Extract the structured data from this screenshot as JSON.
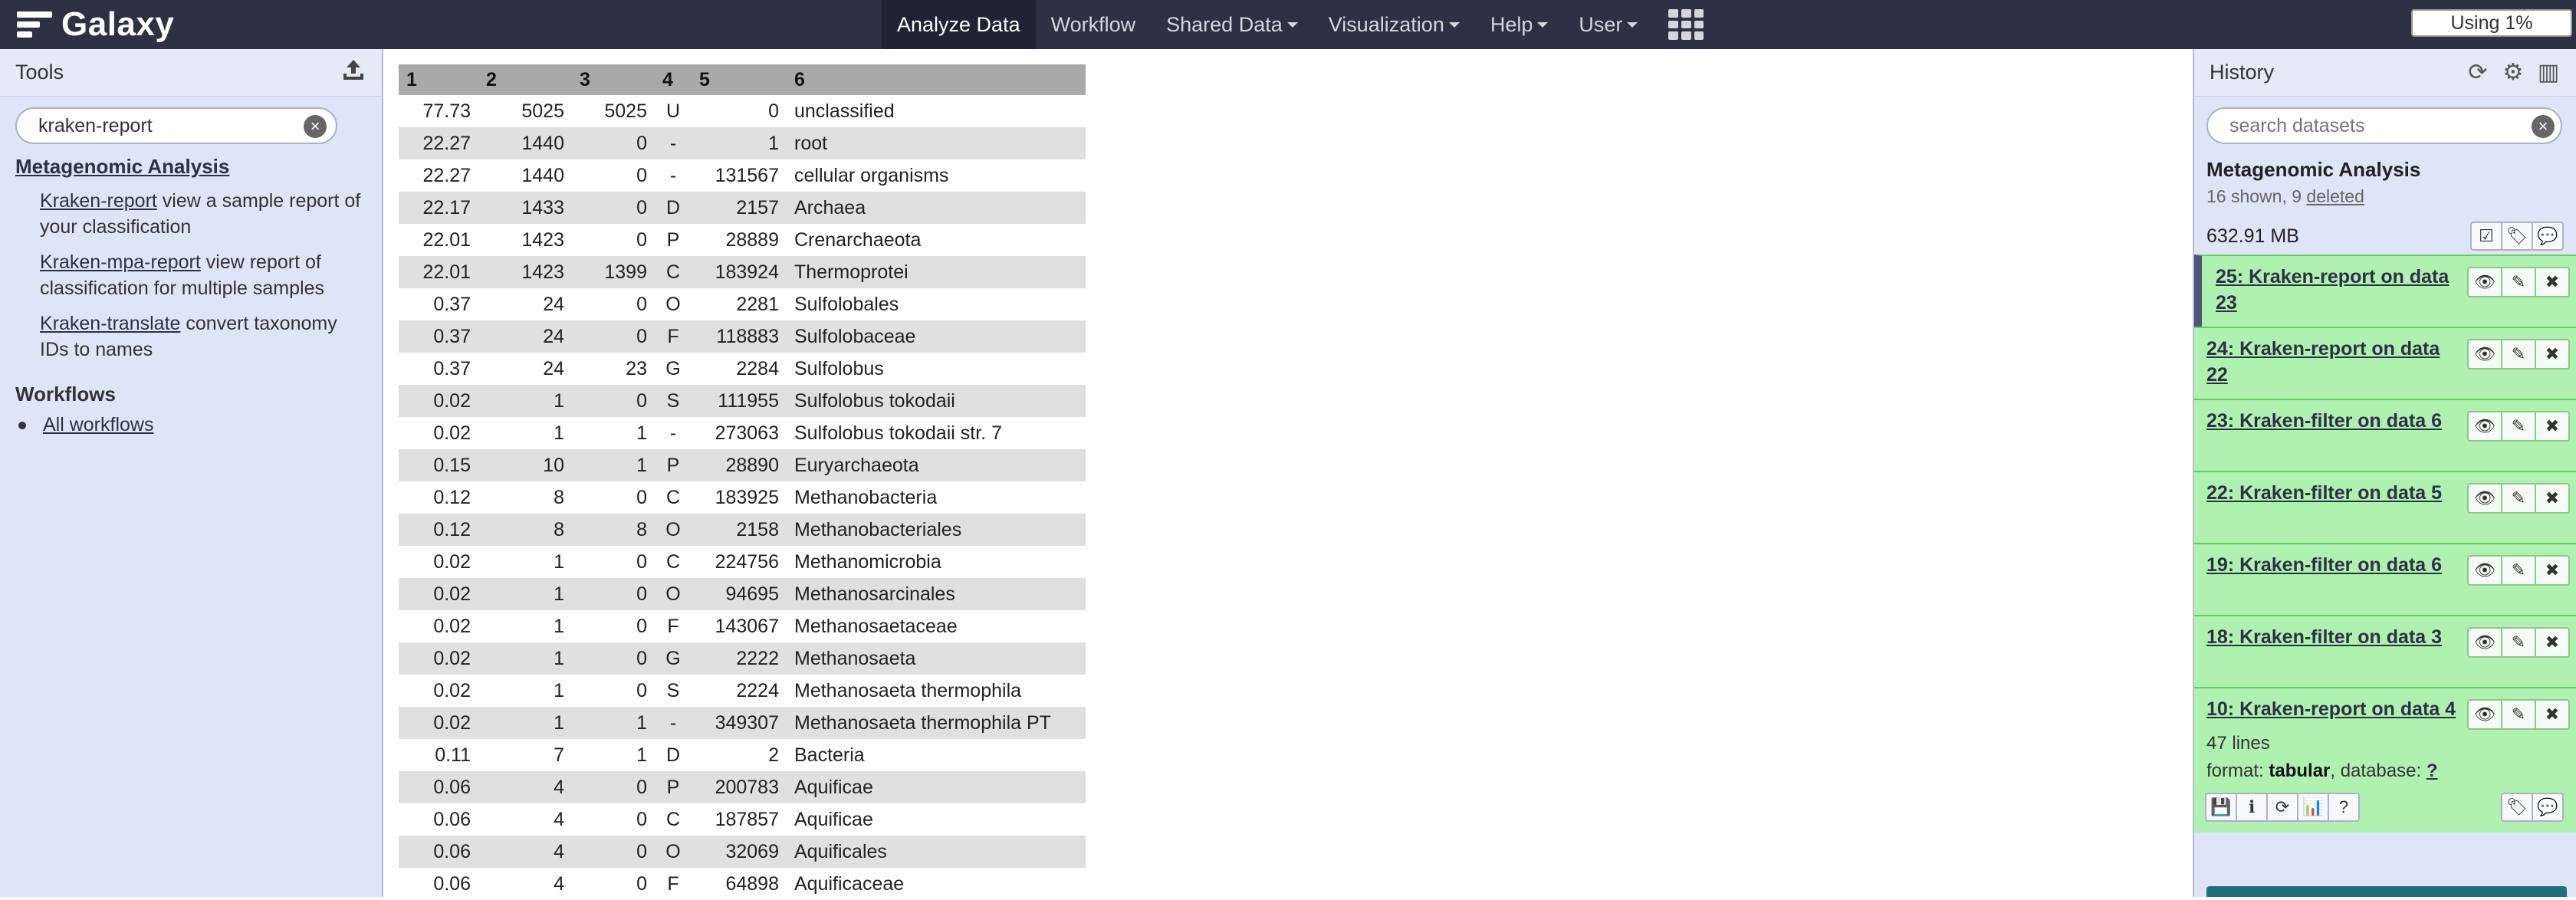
{
  "brand": "Galaxy",
  "nav": [
    {
      "label": "Analyze Data",
      "active": true,
      "dropdown": false
    },
    {
      "label": "Workflow",
      "active": false,
      "dropdown": false
    },
    {
      "label": "Shared Data",
      "active": false,
      "dropdown": true
    },
    {
      "label": "Visualization",
      "active": false,
      "dropdown": true
    },
    {
      "label": "Help",
      "active": false,
      "dropdown": true
    },
    {
      "label": "User",
      "active": false,
      "dropdown": true
    }
  ],
  "quota": "Using 1%",
  "tools": {
    "title": "Tools",
    "search_value": "kraken-report",
    "section": "Metagenomic Analysis",
    "items": [
      {
        "link": "Kraken-report",
        "desc": " view a sample report of your classification"
      },
      {
        "link": "Kraken-mpa-report",
        "desc": " view report of classification for multiple samples"
      },
      {
        "link": "Kraken-translate",
        "desc": " convert taxonomy IDs to names"
      }
    ],
    "workflows_title": "Workflows",
    "all_workflows": "All workflows"
  },
  "table": {
    "headers": [
      "1",
      "2",
      "3",
      "4",
      "5",
      "6"
    ],
    "rows": [
      [
        "77.73",
        "5025",
        "5025",
        "U",
        "0",
        "unclassified"
      ],
      [
        "22.27",
        "1440",
        "0",
        "-",
        "1",
        "root"
      ],
      [
        "22.27",
        "1440",
        "0",
        "-",
        "131567",
        "cellular organisms"
      ],
      [
        "22.17",
        "1433",
        "0",
        "D",
        "2157",
        "Archaea"
      ],
      [
        "22.01",
        "1423",
        "0",
        "P",
        "28889",
        "Crenarchaeota"
      ],
      [
        "22.01",
        "1423",
        "1399",
        "C",
        "183924",
        "Thermoprotei"
      ],
      [
        "0.37",
        "24",
        "0",
        "O",
        "2281",
        "Sulfolobales"
      ],
      [
        "0.37",
        "24",
        "0",
        "F",
        "118883",
        "Sulfolobaceae"
      ],
      [
        "0.37",
        "24",
        "23",
        "G",
        "2284",
        "Sulfolobus"
      ],
      [
        "0.02",
        "1",
        "0",
        "S",
        "111955",
        "Sulfolobus tokodaii"
      ],
      [
        "0.02",
        "1",
        "1",
        "-",
        "273063",
        "Sulfolobus tokodaii str. 7"
      ],
      [
        "0.15",
        "10",
        "1",
        "P",
        "28890",
        "Euryarchaeota"
      ],
      [
        "0.12",
        "8",
        "0",
        "C",
        "183925",
        "Methanobacteria"
      ],
      [
        "0.12",
        "8",
        "8",
        "O",
        "2158",
        "Methanobacteriales"
      ],
      [
        "0.02",
        "1",
        "0",
        "C",
        "224756",
        "Methanomicrobia"
      ],
      [
        "0.02",
        "1",
        "0",
        "O",
        "94695",
        "Methanosarcinales"
      ],
      [
        "0.02",
        "1",
        "0",
        "F",
        "143067",
        "Methanosaetaceae"
      ],
      [
        "0.02",
        "1",
        "0",
        "G",
        "2222",
        "Methanosaeta"
      ],
      [
        "0.02",
        "1",
        "0",
        "S",
        "2224",
        "Methanosaeta thermophila"
      ],
      [
        "0.02",
        "1",
        "1",
        "-",
        "349307",
        "Methanosaeta thermophila PT"
      ],
      [
        "0.11",
        "7",
        "1",
        "D",
        "2",
        "Bacteria"
      ],
      [
        "0.06",
        "4",
        "0",
        "P",
        "200783",
        "Aquificae"
      ],
      [
        "0.06",
        "4",
        "0",
        "C",
        "187857",
        "Aquificae"
      ],
      [
        "0.06",
        "4",
        "0",
        "O",
        "32069",
        "Aquificales"
      ],
      [
        "0.06",
        "4",
        "0",
        "F",
        "64898",
        "Aquificaceae"
      ]
    ]
  },
  "history": {
    "title": "History",
    "search_placeholder": "search datasets",
    "name": "Metagenomic Analysis",
    "shown": "16 shown, 9 ",
    "deleted": "deleted",
    "size": "632.91 MB",
    "datasets": [
      {
        "title": "25: Kraken-report on data 23",
        "current": true
      },
      {
        "title": "24: Kraken-report on data 22",
        "current": false
      },
      {
        "title": "23: Kraken-filter on data 6",
        "current": false
      },
      {
        "title": "22: Kraken-filter on data 5",
        "current": false
      },
      {
        "title": "19: Kraken-filter on data 6",
        "current": false
      },
      {
        "title": "18: Kraken-filter on data 3",
        "current": false
      }
    ],
    "expanded": {
      "title": "10: Kraken-report on data 4",
      "lines": "47 lines",
      "format_label": "format: ",
      "format": "tabular",
      "database_label": ", database: ",
      "database": "?"
    }
  }
}
